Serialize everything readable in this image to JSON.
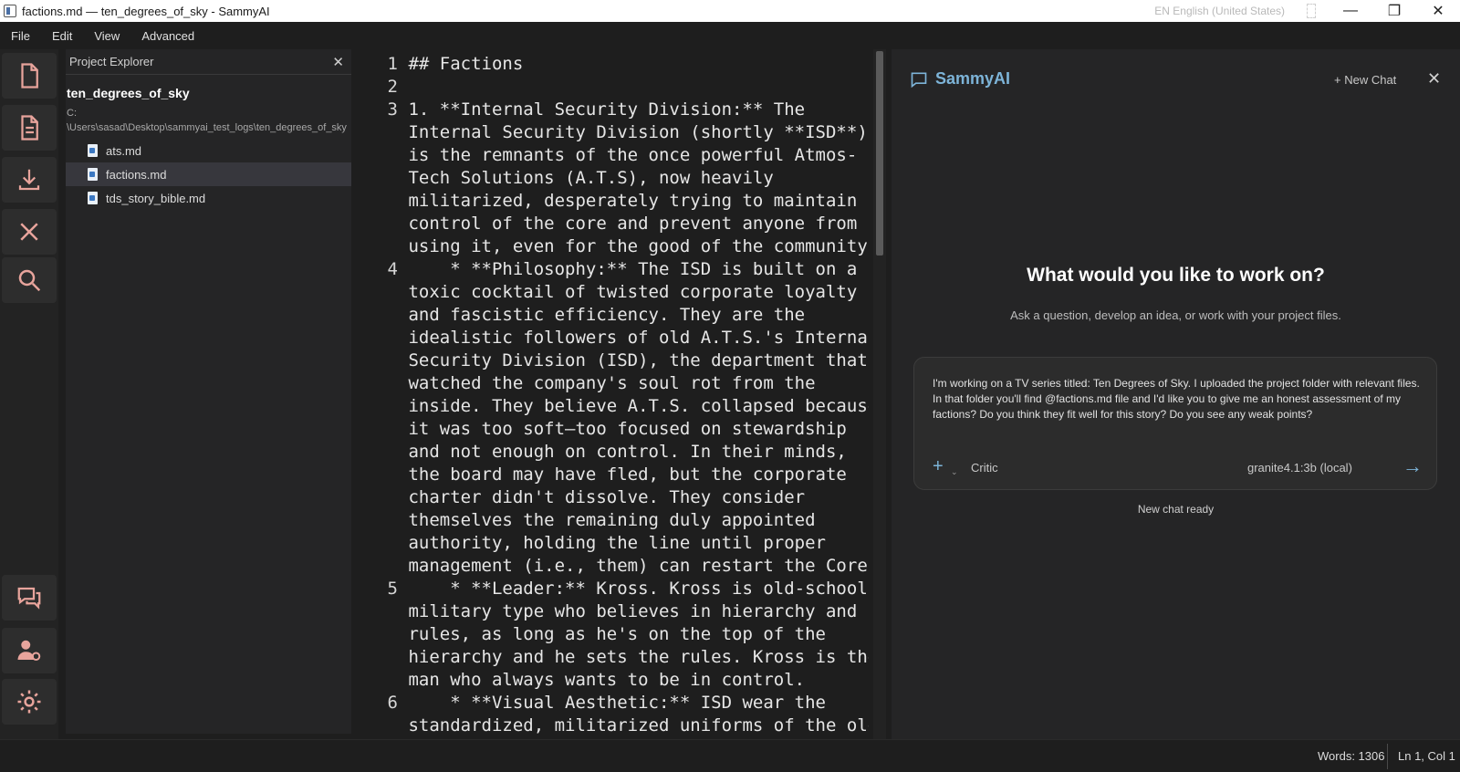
{
  "window": {
    "title": "factions.md — ten_degrees_of_sky - SammyAI",
    "language": "EN English (United States)",
    "controls": {
      "minimize": "—",
      "maximize": "❐",
      "close": "✕"
    }
  },
  "menu": [
    "File",
    "Edit",
    "View",
    "Advanced"
  ],
  "activity_bar": {
    "top_icons": [
      "new-file-icon",
      "document-icon",
      "download-icon",
      "close-icon",
      "search-icon"
    ],
    "bottom_icons": [
      "chat-icon",
      "user-settings-icon",
      "gear-icon"
    ],
    "accent_color": "#e8a49c"
  },
  "explorer": {
    "header": "Project Explorer",
    "close": "✕",
    "project_name": "ten_degrees_of_sky",
    "project_path_line1": "C:",
    "project_path_line2": "\\Users\\sasad\\Desktop\\sammyai_test_logs\\ten_degrees_of_sky",
    "files": [
      {
        "name": "ats.md",
        "active": false
      },
      {
        "name": "factions.md",
        "active": true
      },
      {
        "name": "tds_story_bible.md",
        "active": false
      }
    ]
  },
  "editor": {
    "lines": [
      {
        "n": "1",
        "rows": [
          "## Factions"
        ]
      },
      {
        "n": "2",
        "rows": [
          ""
        ]
      },
      {
        "n": "3",
        "rows": [
          "1. **Internal Security Division:** The",
          "Internal Security Division (shortly **ISD**)",
          "is the remnants of the once powerful Atmos-",
          "Tech Solutions (A.T.S), now heavily",
          "militarized, desperately trying to maintain",
          "control of the core and prevent anyone from",
          "using it, even for the good of the community."
        ]
      },
      {
        "n": "4",
        "rows": [
          "    * **Philosophy:** The ISD is built on a",
          "toxic cocktail of twisted corporate loyalty",
          "and fascistic efficiency. They are the",
          "idealistic followers of old A.T.S.'s Internal",
          "Security Division (ISD), the department that",
          "watched the company's soul rot from the",
          "inside. They believe A.T.S. collapsed because",
          "it was too soft—too focused on stewardship",
          "and not enough on control. In their minds,",
          "the board may have fled, but the corporate",
          "charter didn't dissolve. They consider",
          "themselves the remaining duly appointed",
          "authority, holding the line until proper",
          "management (i.e., them) can restart the Core."
        ]
      },
      {
        "n": "5",
        "rows": [
          "    * **Leader:** Kross. Kross is old-school",
          "military type who believes in hierarchy and",
          "rules, as long as he's on the top of the",
          "hierarchy and he sets the rules. Kross is the",
          "man who always wants to be in control."
        ]
      },
      {
        "n": "6",
        "rows": [
          "    * **Visual Aesthetic:** ISD wear the",
          "standardized, militarized uniforms of the old"
        ]
      }
    ]
  },
  "chat": {
    "brand": "SammyAI",
    "new_chat": "+ New Chat",
    "close": "✕",
    "welcome_title": "What would you like to work on?",
    "welcome_sub": "Ask a question, develop an idea, or work with your project files.",
    "prompt": "I'm working on a TV series titled: Ten Degrees of Sky. I uploaded the project folder with relevant files. In that folder you'll find @factions.md file and I'd like you to give me an honest assessment of my factions? Do you think they fit well for this story? Do you see any weak points?",
    "attach": "+",
    "attach_caret": "⌄",
    "mode": "Critic",
    "model": "granite4.1:3b (local)",
    "send": "→",
    "status": "New chat ready",
    "accent_color": "#7db4d8"
  },
  "status_bar": {
    "words": "Words: 1306",
    "position": "Ln 1, Col 1"
  }
}
